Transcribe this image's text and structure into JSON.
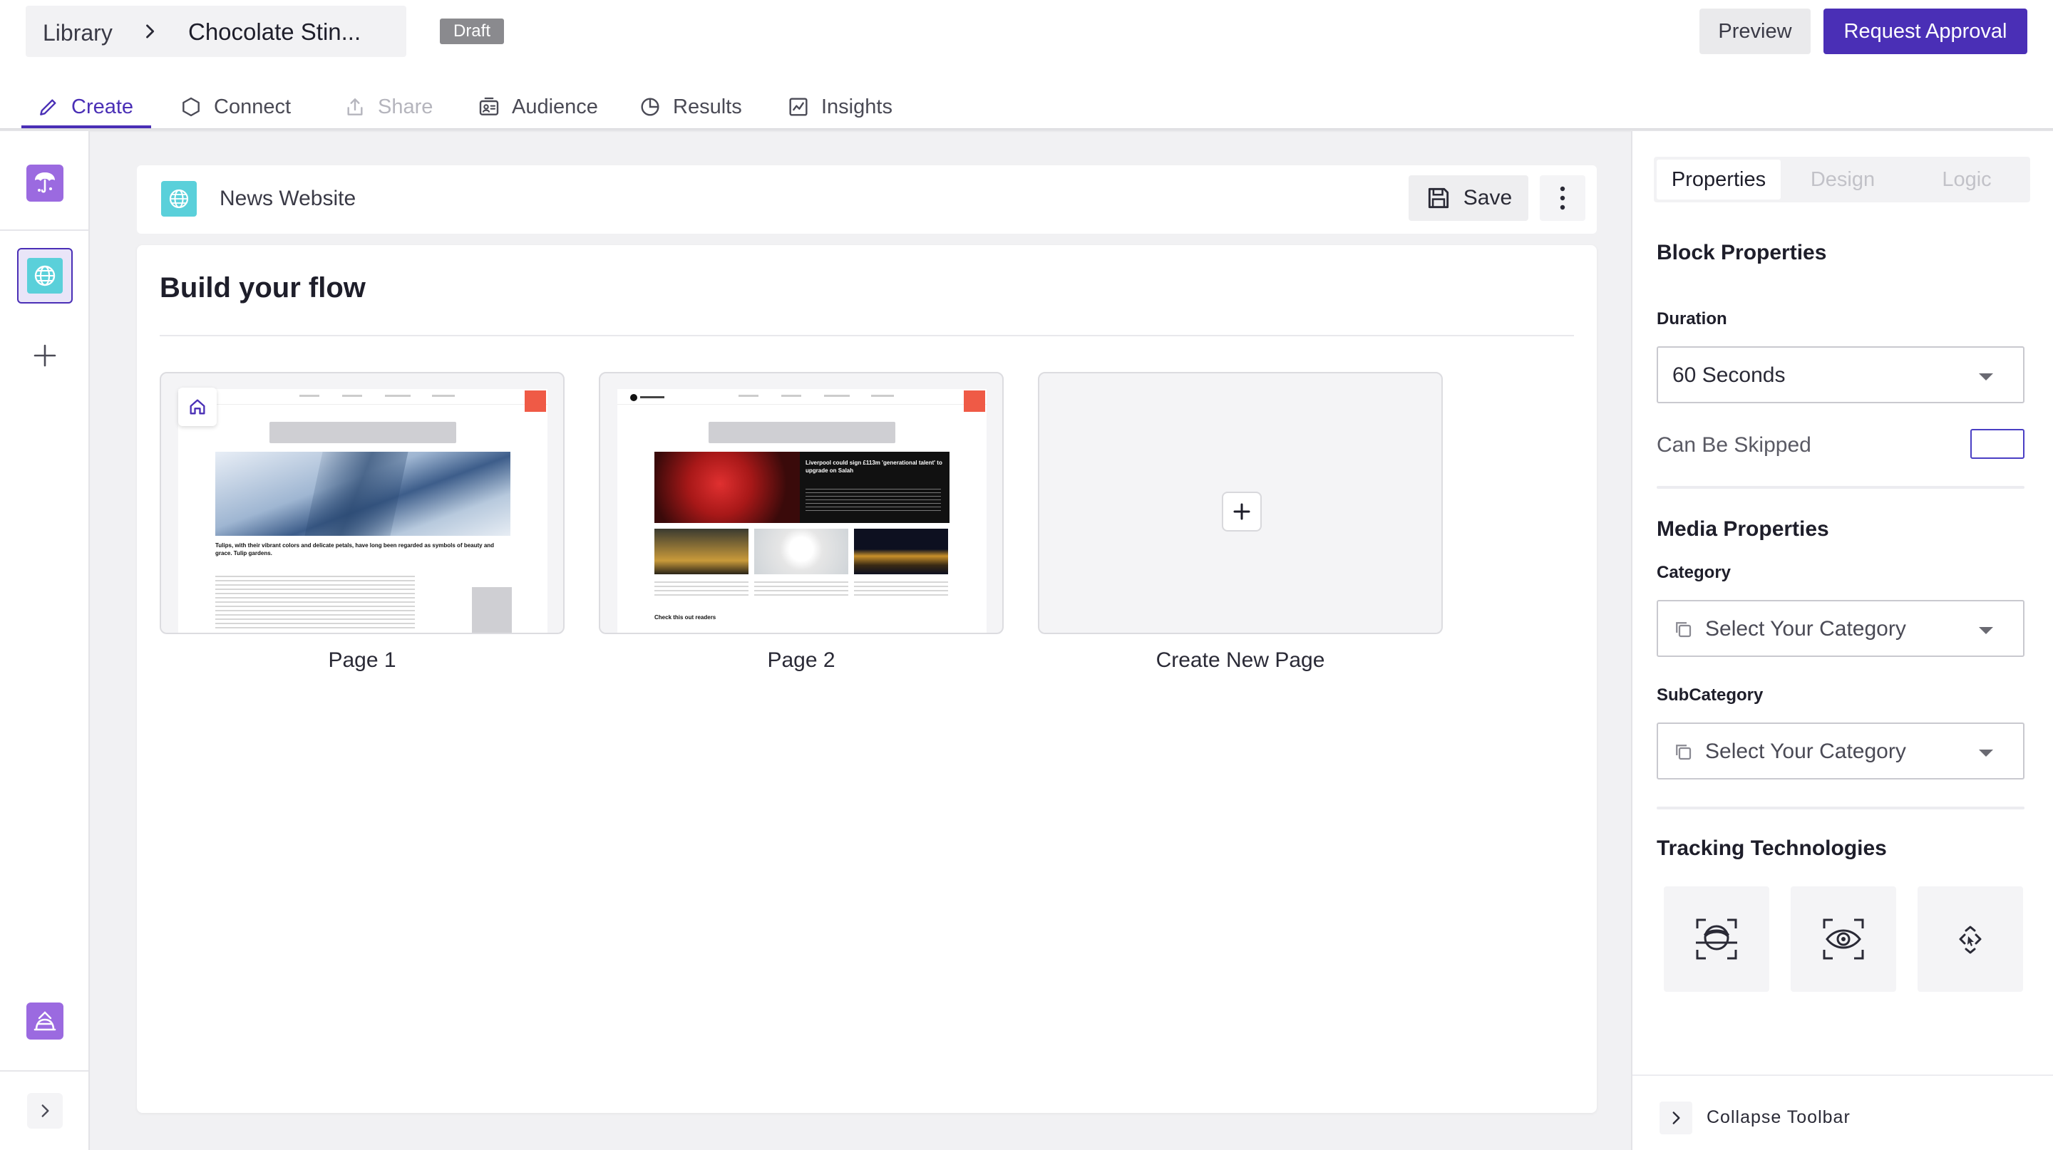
{
  "header": {
    "breadcrumb_root": "Library",
    "breadcrumb_current": "Chocolate Stin...",
    "status_badge": "Draft",
    "preview_label": "Preview",
    "request_approval_label": "Request Approval"
  },
  "tabs": [
    {
      "label": "Create",
      "icon": "pencil-icon",
      "state": "active"
    },
    {
      "label": "Connect",
      "icon": "hexagon-icon",
      "state": "normal"
    },
    {
      "label": "Share",
      "icon": "share-icon",
      "state": "disabled"
    },
    {
      "label": "Audience",
      "icon": "audience-icon",
      "state": "normal"
    },
    {
      "label": "Results",
      "icon": "pie-chart-icon",
      "state": "normal"
    },
    {
      "label": "Insights",
      "icon": "line-chart-icon",
      "state": "normal"
    }
  ],
  "left_rail": {
    "icons": [
      "survey-icon",
      "globe-icon",
      "plus-icon",
      "cake-icon",
      "expand-chevron-icon"
    ]
  },
  "block_bar": {
    "name": "News Website",
    "save_label": "Save"
  },
  "flow": {
    "title": "Build your flow",
    "pages": [
      {
        "label": "Page 1",
        "thumb_headline": "Tulips, with their vibrant colors and delicate petals, have long been regarded as symbols of beauty and grace. Tulip gardens."
      },
      {
        "label": "Page 2",
        "thumb_headline": "Liverpool could sign £113m 'generational talent' to upgrade on Salah",
        "thumb_footer": "Check this out readers"
      }
    ],
    "create_new_label": "Create New Page"
  },
  "right_panel": {
    "tabs": [
      "Properties",
      "Design",
      "Logic"
    ],
    "block_properties_title": "Block Properties",
    "duration_label": "Duration",
    "duration_value": "60 Seconds",
    "can_be_skipped_label": "Can Be Skipped",
    "media_properties_title": "Media Properties",
    "category_label": "Category",
    "category_placeholder": "Select Your Category",
    "subcategory_label": "SubCategory",
    "subcategory_placeholder": "Select Your Category",
    "tracking_title": "Tracking Technologies",
    "tracking_icons": [
      "face-tracking-icon",
      "eye-tracking-icon",
      "cursor-tracking-icon"
    ],
    "collapse_label": "Collapse Toolbar"
  },
  "colors": {
    "accent": "#4a2fb6",
    "globe": "#5ad0da",
    "survey_purple": "#9b6ae0"
  }
}
